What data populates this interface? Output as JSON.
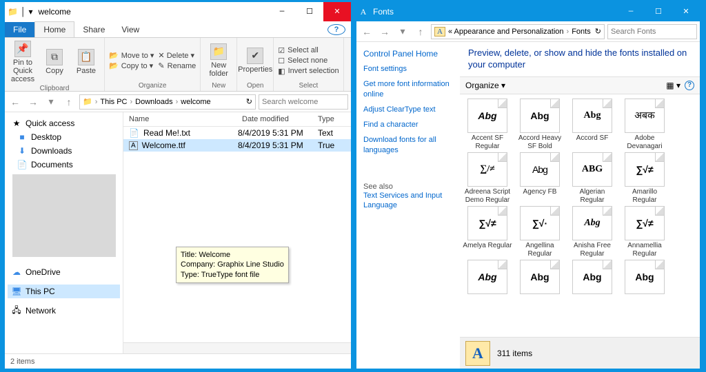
{
  "left": {
    "title": "welcome",
    "tabs": {
      "file": "File",
      "home": "Home",
      "share": "Share",
      "view": "View"
    },
    "ribbon": {
      "clipboard": {
        "label": "Clipboard",
        "pin": "Pin to Quick access",
        "copy": "Copy",
        "paste": "Paste"
      },
      "organize": {
        "label": "Organize",
        "moveto": "Move to ▾",
        "copyto": "Copy to ▾",
        "delete": "✕ Delete ▾",
        "rename": "Rename"
      },
      "new": {
        "label": "New",
        "newfolder": "New folder"
      },
      "open": {
        "label": "Open",
        "properties": "Properties"
      },
      "select": {
        "label": "Select",
        "all": "Select all",
        "none": "Select none",
        "invert": "Invert selection"
      }
    },
    "addr": {
      "pc": "This PC",
      "downloads": "Downloads",
      "welcome": "welcome"
    },
    "search_placeholder": "Search welcome",
    "nav": {
      "quick": "Quick access",
      "desktop": "Desktop",
      "downloads": "Downloads",
      "documents": "Documents",
      "onedrive": "OneDrive",
      "thispc": "This PC",
      "network": "Network"
    },
    "cols": {
      "name": "Name",
      "date": "Date modified",
      "type": "Type"
    },
    "files": [
      {
        "name": "Read Me!.txt",
        "date": "8/4/2019 5:31 PM",
        "type": "Text"
      },
      {
        "name": "Welcome.ttf",
        "date": "8/4/2019 5:31 PM",
        "type": "True"
      }
    ],
    "tooltip": {
      "l1": "Title: Welcome",
      "l2": "Company: Graphix Line Studio",
      "l3": "Type: TrueType font file"
    },
    "status": "2 items"
  },
  "right": {
    "title": "Fonts",
    "breadcrumb": {
      "prefix": "«  Appearance and Personalization",
      "leaf": "Fonts"
    },
    "search_placeholder": "Search Fonts",
    "side": {
      "home": "Control Panel Home",
      "links": [
        "Font settings",
        "Get more font information online",
        "Adjust ClearType text",
        "Find a character",
        "Download fonts for all languages"
      ],
      "seealso": "See also",
      "seealso_links": [
        "Text Services and Input Language"
      ]
    },
    "heading": "Preview, delete, or show and hide the fonts installed on your computer",
    "organize": "Organize ▾",
    "fonts": [
      {
        "name": "Accent SF Regular",
        "sample": "Abg",
        "style": "font-weight:900;font-style:italic"
      },
      {
        "name": "Accord Heavy SF Bold",
        "sample": "Abg",
        "style": "font-weight:900"
      },
      {
        "name": "Accord SF",
        "sample": "Abg",
        "style": "font-family:serif"
      },
      {
        "name": "Adobe Devanagari",
        "sample": "अबक",
        "style": "font-weight:normal"
      },
      {
        "name": "Adreena Script Demo Regular",
        "sample": "∑/≠",
        "style": "font-family:serif"
      },
      {
        "name": "Agency FB",
        "sample": "Abg",
        "style": "font-weight:300;letter-spacing:-1px"
      },
      {
        "name": "Algerian Regular",
        "sample": "ABG",
        "style": "font-family:serif;font-weight:bold"
      },
      {
        "name": "Amarillo Regular",
        "sample": "∑√≠",
        "style": ""
      },
      {
        "name": "Amelya Regular",
        "sample": "∑√≠",
        "style": ""
      },
      {
        "name": "Angellina Regular",
        "sample": "∑√·",
        "style": ""
      },
      {
        "name": "Anisha Free Regular",
        "sample": "Abg",
        "style": "font-style:italic;font-family:cursive"
      },
      {
        "name": "Annamellia Regular",
        "sample": "∑√≠",
        "style": ""
      },
      {
        "name": "",
        "sample": "Abg",
        "style": "font-weight:900;font-style:italic"
      },
      {
        "name": "",
        "sample": "Abg",
        "style": ""
      },
      {
        "name": "",
        "sample": "Abg",
        "style": "font-weight:bold"
      },
      {
        "name": "",
        "sample": "Abg",
        "style": ""
      }
    ],
    "status": "311 items"
  }
}
